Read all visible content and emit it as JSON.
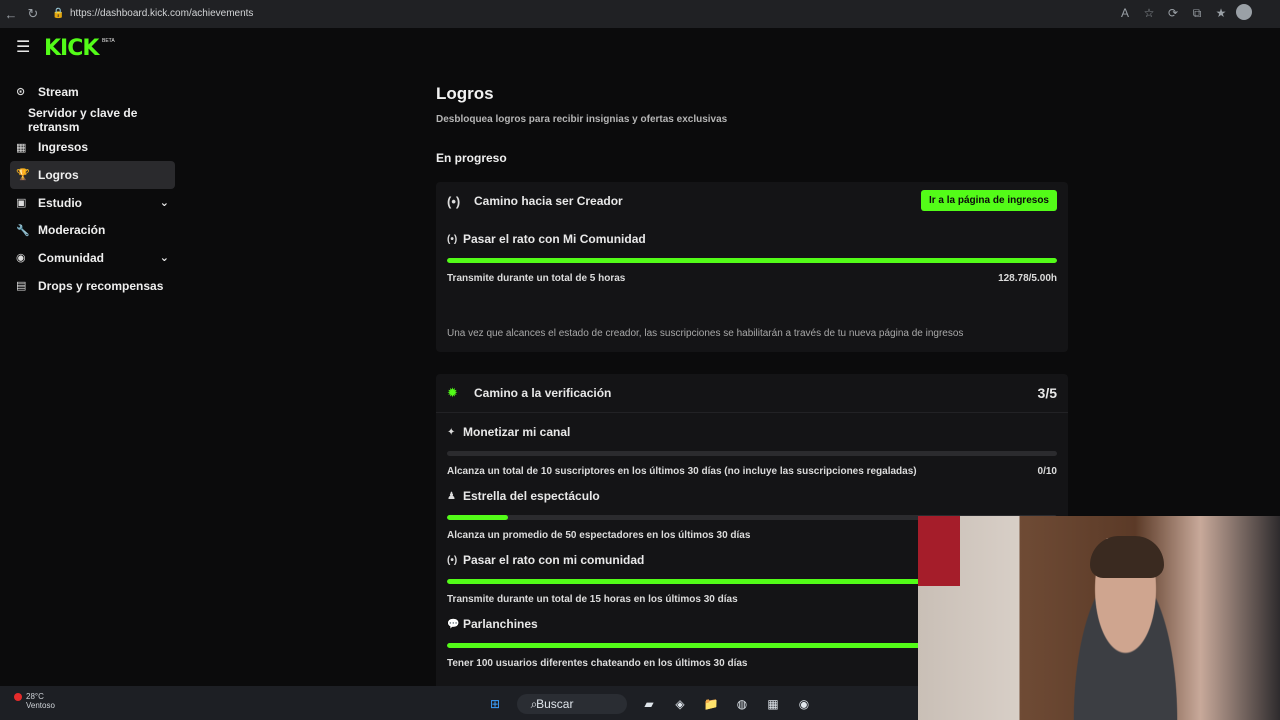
{
  "browser": {
    "url": "https://dashboard.kick.com/achievements"
  },
  "brand": {
    "logo": "KICK",
    "beta": "BETA",
    "accent_color": "#53fc18"
  },
  "sidebar": {
    "items": [
      {
        "label": "Stream",
        "icon": "broadcast-icon"
      },
      {
        "label": "Servidor y clave de retransm",
        "icon": ""
      },
      {
        "label": "Ingresos",
        "icon": "chart-icon"
      },
      {
        "label": "Logros",
        "icon": "trophy-icon"
      },
      {
        "label": "Estudio",
        "icon": "studio-icon"
      },
      {
        "label": "Moderación",
        "icon": "wrench-icon"
      },
      {
        "label": "Comunidad",
        "icon": "community-icon"
      },
      {
        "label": "Drops y recompensas",
        "icon": "gift-icon"
      }
    ]
  },
  "page": {
    "title": "Logros",
    "subtitle": "Desbloquea logros para recibir insignias y ofertas exclusivas",
    "section": "En progreso"
  },
  "creator_card": {
    "title": "Camino hacia ser Creador",
    "button": "Ir a la página de ingresos",
    "task": {
      "title": "Pasar el rato con Mi Comunidad",
      "description": "Transmite durante un total de 5 horas",
      "value": "128.78/5.00h",
      "progress": 1.0
    },
    "note": "Una vez que alcances el estado de creador, las suscripciones se habilitarán a través de tu nueva página de ingresos"
  },
  "verification_card": {
    "title": "Camino a la verificación",
    "count": "3/5",
    "tasks": [
      {
        "title": "Monetizar mi canal",
        "description": "Alcanza un total de 10 suscriptores en los últimos 30 días (no incluye las suscripciones regaladas)",
        "value": "0/10",
        "progress": 0.0
      },
      {
        "title": "Estrella del espectáculo",
        "description": "Alcanza un promedio de 50 espectadores en los últimos 30 días",
        "value": "",
        "progress": 0.1
      },
      {
        "title": "Pasar el rato con mi comunidad",
        "description": "Transmite durante un total de 15 horas en los últimos 30 días",
        "value": "",
        "progress": 1.0
      },
      {
        "title": "Parlanchines",
        "description": "Tener 100 usuarios diferentes chateando en los últimos 30 días",
        "value": "",
        "progress": 1.0
      }
    ]
  },
  "taskbar": {
    "temperature": "28°C",
    "weather": "Ventoso",
    "search": "Buscar"
  }
}
